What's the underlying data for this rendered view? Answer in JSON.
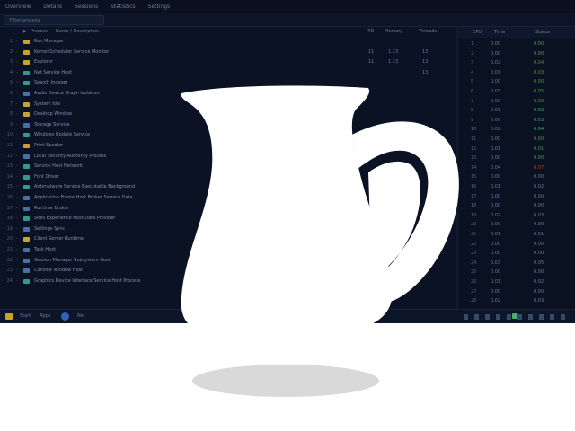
{
  "menubar": {
    "items": [
      "Overview",
      "Details",
      "Sessions",
      "Statistics",
      "Settings"
    ]
  },
  "filter": {
    "placeholder": "Filter process"
  },
  "tree_header": {
    "expand": "▶",
    "name": "Process",
    "desc": "Name / Description",
    "c1": "PID",
    "c2": "Memory",
    "c3": "Threads"
  },
  "tree_rows": [
    {
      "num": "1",
      "mark": "-",
      "color": "#c9a227",
      "label": "Run Manager",
      "c1": "",
      "c2": "",
      "c3": ""
    },
    {
      "num": "2",
      "mark": "-",
      "color": "#c9a227",
      "label": "Kernel Scheduler Service Monitor",
      "c1": "11",
      "c2": "1.23",
      "c3": "13"
    },
    {
      "num": "3",
      "mark": "-",
      "color": "#c9a227",
      "label": "Explorer",
      "c1": "11",
      "c2": "1.23",
      "c3": "13"
    },
    {
      "num": "4",
      "mark": "-",
      "color": "#2a9d8f",
      "label": "Net Service Host",
      "c1": "",
      "c2": "",
      "c3": "13"
    },
    {
      "num": "5",
      "mark": "-",
      "color": "#2a9d8f",
      "label": "Search Indexer",
      "c1": "",
      "c2": "",
      "c3": ""
    },
    {
      "num": "6",
      "mark": "-",
      "color": "#4a6fa5",
      "label": "Audio Device Graph Isolation",
      "c1": "",
      "c2": "",
      "c3": ""
    },
    {
      "num": "7",
      "mark": "-",
      "color": "#c9a227",
      "label": "System Idle",
      "c1": "",
      "c2": "",
      "c3": ""
    },
    {
      "num": "8",
      "mark": "-",
      "color": "#c9a227",
      "label": "Desktop Window",
      "c1": "",
      "c2": "",
      "c3": ""
    },
    {
      "num": "9",
      "mark": "-",
      "color": "#4a6fa5",
      "label": "Storage Service",
      "c1": "",
      "c2": "",
      "c3": ""
    },
    {
      "num": "10",
      "mark": "-",
      "color": "#2a9d8f",
      "label": "Windows Update Service",
      "c1": "",
      "c2": "",
      "c3": ""
    },
    {
      "num": "11",
      "mark": "-",
      "color": "#c9a227",
      "label": "Print Spooler",
      "c1": "",
      "c2": "",
      "c3": ""
    },
    {
      "num": "12",
      "mark": "-",
      "color": "#4a6fa5",
      "label": "Local Security Authority Process",
      "c1": "",
      "c2": "",
      "c3": ""
    },
    {
      "num": "13",
      "mark": "-",
      "color": "#2a9d8f",
      "label": "Service Host Network",
      "c1": "",
      "c2": "",
      "c3": ""
    },
    {
      "num": "14",
      "mark": "-",
      "color": "#2a9d8f",
      "label": "Font Driver",
      "c1": "",
      "c2": "",
      "c3": ""
    },
    {
      "num": "15",
      "mark": "-",
      "color": "#2a9d8f",
      "label": "Antimalware Service Executable Background",
      "c1": "",
      "c2": "",
      "c3": ""
    },
    {
      "num": "16",
      "mark": "-",
      "color": "#4a6fa5",
      "label": "Application Frame Host Broker Service Data",
      "c1": "",
      "c2": "",
      "c3": ""
    },
    {
      "num": "17",
      "mark": "-",
      "color": "#4a6fa5",
      "label": "Runtime Broker",
      "c1": "",
      "c2": "",
      "c3": ""
    },
    {
      "num": "18",
      "mark": "-",
      "color": "#2a9d8f",
      "label": "Shell Experience Host Data Provider",
      "c1": "",
      "c2": "",
      "c3": ""
    },
    {
      "num": "19",
      "mark": "-",
      "color": "#4a6fa5",
      "label": "Settings Sync",
      "c1": "",
      "c2": "",
      "c3": ""
    },
    {
      "num": "20",
      "mark": "-",
      "color": "#c9a227",
      "label": "Client Server Runtime",
      "c1": "",
      "c2": "",
      "c3": ""
    },
    {
      "num": "21",
      "mark": "-",
      "color": "#4a6fa5",
      "label": "Task Host",
      "c1": "",
      "c2": "",
      "c3": ""
    },
    {
      "num": "22",
      "mark": "-",
      "color": "#4a6fa5",
      "label": "Session Manager Subsystem Host",
      "c1": "",
      "c2": "",
      "c3": ""
    },
    {
      "num": "23",
      "mark": "-",
      "color": "#4a6fa5",
      "label": "Console Window Host",
      "c1": "",
      "c2": "",
      "c3": ""
    },
    {
      "num": "24",
      "mark": "-",
      "color": "#2a9d8f",
      "label": "Graphics Device Interface Service Host Process",
      "c1": "",
      "c2": "",
      "c3": ""
    }
  ],
  "data_header": {
    "a": "CPU",
    "b": "Time",
    "c": "Status"
  },
  "data_rows": [
    {
      "idx": "1",
      "val": "0.00",
      "stat": "0.00",
      "color": "#5f8f5a"
    },
    {
      "idx": "2",
      "val": "0.00",
      "stat": "0.00",
      "color": "#5f8f5a"
    },
    {
      "idx": "3",
      "val": "0.02",
      "stat": "0.04",
      "color": "#5f8f5a"
    },
    {
      "idx": "4",
      "val": "0.01",
      "stat": "0.03",
      "color": "#5f8f5a"
    },
    {
      "idx": "5",
      "val": "0.00",
      "stat": "0.00",
      "color": "#5f8f5a"
    },
    {
      "idx": "6",
      "val": "0.03",
      "stat": "0.05",
      "color": "#5f8f5a"
    },
    {
      "idx": "7",
      "val": "0.00",
      "stat": "0.00",
      "color": "#5f8f5a"
    },
    {
      "idx": "8",
      "val": "0.01",
      "stat": "0.02",
      "color": "#3fb46a"
    },
    {
      "idx": "9",
      "val": "0.00",
      "stat": "0.03",
      "color": "#3fb46a"
    },
    {
      "idx": "10",
      "val": "0.02",
      "stat": "0.04",
      "color": "#3fb46a"
    },
    {
      "idx": "11",
      "val": "0.00",
      "stat": "0.00",
      "color": "#5f8f5a"
    },
    {
      "idx": "12",
      "val": "0.01",
      "stat": "0.01",
      "color": "#5f8f5a"
    },
    {
      "idx": "13",
      "val": "0.00",
      "stat": "0.00",
      "color": "#5f8f5a"
    },
    {
      "idx": "14",
      "val": "0.04",
      "stat": "0.07",
      "color": "#c0392b"
    },
    {
      "idx": "15",
      "val": "0.00",
      "stat": "0.00",
      "color": "#6c7d9c"
    },
    {
      "idx": "16",
      "val": "0.01",
      "stat": "0.02",
      "color": "#6c7d9c"
    },
    {
      "idx": "17",
      "val": "0.00",
      "stat": "0.00",
      "color": "#6c7d9c"
    },
    {
      "idx": "18",
      "val": "0.00",
      "stat": "0.00",
      "color": "#6c7d9c"
    },
    {
      "idx": "19",
      "val": "0.02",
      "stat": "0.03",
      "color": "#6c7d9c"
    },
    {
      "idx": "20",
      "val": "0.00",
      "stat": "0.00",
      "color": "#6c7d9c"
    },
    {
      "idx": "21",
      "val": "0.01",
      "stat": "0.01",
      "color": "#6c7d9c"
    },
    {
      "idx": "22",
      "val": "0.00",
      "stat": "0.00",
      "color": "#6c7d9c"
    },
    {
      "idx": "23",
      "val": "0.00",
      "stat": "0.00",
      "color": "#6c7d9c"
    },
    {
      "idx": "24",
      "val": "0.03",
      "stat": "0.05",
      "color": "#6c7d9c"
    },
    {
      "idx": "25",
      "val": "0.00",
      "stat": "0.00",
      "color": "#6c7d9c"
    },
    {
      "idx": "26",
      "val": "0.01",
      "stat": "0.02",
      "color": "#6c7d9c"
    },
    {
      "idx": "27",
      "val": "0.00",
      "stat": "0.00",
      "color": "#6c7d9c"
    },
    {
      "idx": "28",
      "val": "0.02",
      "stat": "0.03",
      "color": "#6c7d9c"
    }
  ],
  "statusbar": {
    "left": "Start",
    "mid1": "Apps",
    "mid2": "Net"
  },
  "colors": {
    "screen_bg": "#0b1224",
    "pitcher": "#ffffff",
    "shadow": "#d9d9d9",
    "accent_blue": "#3f7bd9"
  },
  "overlay": {
    "object": "pitcher-silhouette"
  }
}
